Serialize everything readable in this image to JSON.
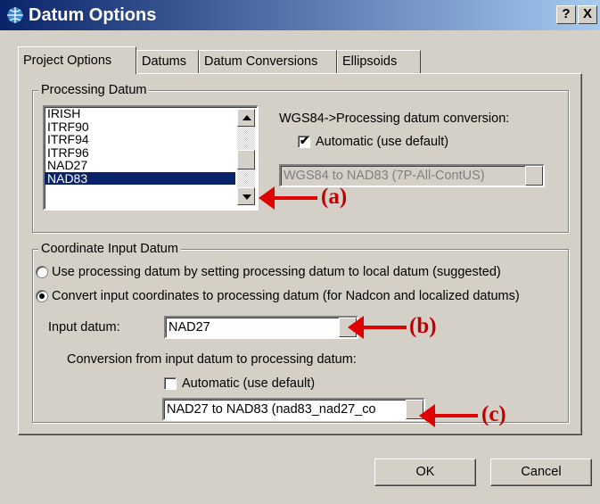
{
  "window": {
    "title": "Datum Options",
    "help_button": "?",
    "close_button": "X"
  },
  "tabs": [
    {
      "label": "Project Options",
      "active": true
    },
    {
      "label": "Datums",
      "active": false
    },
    {
      "label": "Datum Conversions",
      "active": false
    },
    {
      "label": "Ellipsoids",
      "active": false
    }
  ],
  "processing_datum": {
    "legend": "Processing Datum",
    "items": [
      "IRISH",
      "ITRF90",
      "ITRF94",
      "ITRF96",
      "NAD27",
      "NAD83"
    ],
    "selected": "NAD83",
    "conversion_label": "WGS84->Processing datum conversion:",
    "automatic_label": "Automatic (use default)",
    "automatic_checked": true,
    "conversion_value": "WGS84 to NAD83 (7P-All-ContUS)"
  },
  "coordinate_input": {
    "legend": "Coordinate Input Datum",
    "option_use_processing": "Use processing datum by setting processing datum to local datum (suggested)",
    "option_convert": "Convert input coordinates to processing datum (for Nadcon and localized datums)",
    "selected_option": "convert",
    "input_datum_label": "Input datum:",
    "input_datum_value": "NAD27",
    "conversion_label": "Conversion from input datum to processing datum:",
    "automatic_label": "Automatic (use default)",
    "automatic_checked": false,
    "conversion_value": "NAD27 to NAD83 (nad83_nad27_co"
  },
  "buttons": {
    "ok": "OK",
    "cancel": "Cancel"
  },
  "annotations": {
    "a": "(a)",
    "b": "(b)",
    "c": "(c)"
  },
  "colors": {
    "title_bar": "#0a246a",
    "selection": "#0a246a",
    "face": "#d4d0c8",
    "annotation": "#e00000"
  }
}
